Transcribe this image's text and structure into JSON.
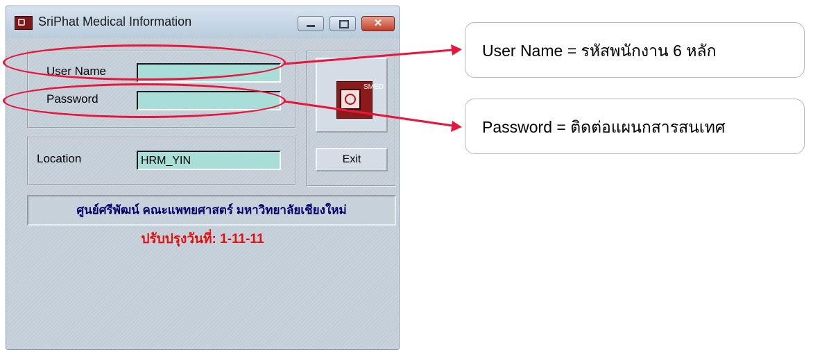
{
  "window": {
    "title": "SriPhat Medical Information",
    "buttons": {
      "minimize": "minimize",
      "maximize": "maximize",
      "close": "close"
    }
  },
  "login": {
    "username_label": "User Name",
    "username_value": "",
    "password_label": "Password",
    "password_value": ""
  },
  "location": {
    "label": "Location",
    "value": "HRM_YIN"
  },
  "logo": {
    "text": "SMED"
  },
  "exit_button": "Exit",
  "banner_text": "ศูนย์ศรีพัฒน์ คณะแพทยศาสตร์ มหาวิทยาลัยเชียงใหม่",
  "updated_text": "ปรับปรุงวันที่: 1-11-11",
  "callouts": {
    "username": "User Name = รหัสพนักงาน 6 หลัก",
    "password": "Password = ติดต่อแผนกสารสนเทศ"
  },
  "colors": {
    "highlight": "#e8163c",
    "field_bg": "#a8ddd8",
    "banner_text": "#00006a",
    "updated_text": "#e21010"
  }
}
